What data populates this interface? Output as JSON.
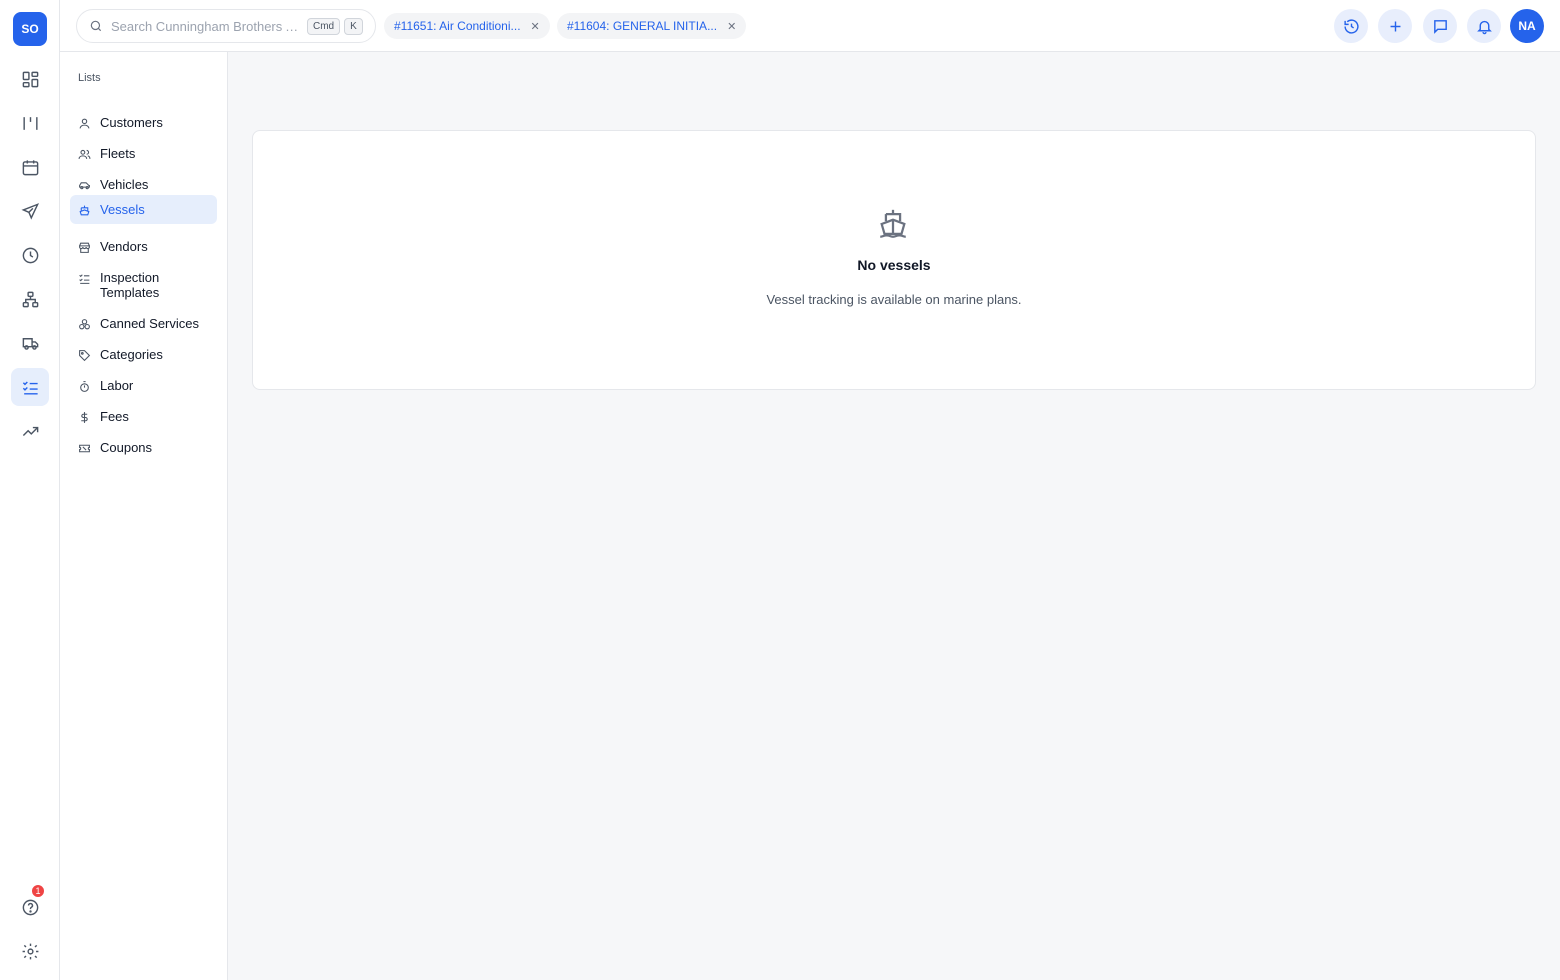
{
  "rail": {
    "logo": "SO",
    "help_badge": "1"
  },
  "topbar": {
    "search_placeholder": "Search Cunningham Brothers A...",
    "kbd_cmd": "Cmd",
    "kbd_k": "K",
    "open_tabs": [
      {
        "label": "#11651: Air Conditioni..."
      },
      {
        "label": "#11604: GENERAL INITIA..."
      }
    ],
    "avatar": "NA"
  },
  "subnav": {
    "heading": "Lists",
    "items": [
      {
        "label": "Customers",
        "icon": "user-icon"
      },
      {
        "label": "Fleets",
        "icon": "users-icon"
      },
      {
        "label": "Vehicles",
        "icon": "car-icon"
      },
      {
        "label": "Vessels",
        "icon": "ship-icon",
        "active": true
      },
      {
        "label": "Vendors",
        "icon": "store-icon"
      },
      {
        "label": "Inspection Templates",
        "icon": "checklist-icon"
      },
      {
        "label": "Canned Services",
        "icon": "boxes-icon"
      },
      {
        "label": "Categories",
        "icon": "tag-icon"
      },
      {
        "label": "Labor",
        "icon": "timer-icon"
      },
      {
        "label": "Fees",
        "icon": "dollar-icon"
      },
      {
        "label": "Coupons",
        "icon": "ticket-icon"
      }
    ]
  },
  "main": {
    "empty_title": "No vessels",
    "empty_message": "Vessel tracking is available on marine plans."
  },
  "colors": {
    "accent": "#2563eb",
    "active_bg": "#e6eefc",
    "badge": "#ef4444"
  }
}
